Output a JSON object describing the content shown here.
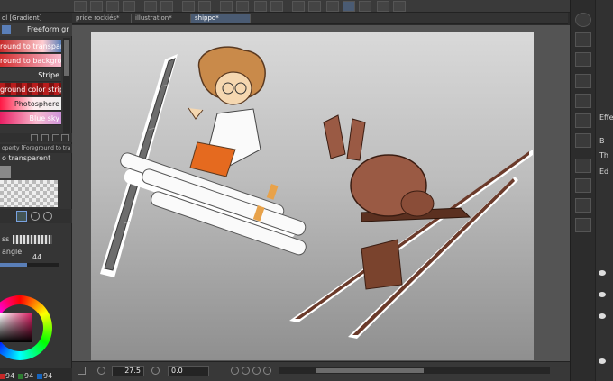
{
  "window": {
    "active_tool_header": "ol [Gradient]"
  },
  "tabs": [
    {
      "label": "pride rockiés*"
    },
    {
      "label": "illustration*"
    },
    {
      "label": "shippo*"
    }
  ],
  "tool_panel": {
    "subtool_label": "Freeform gr",
    "gradients": [
      {
        "label": "round to transparent"
      },
      {
        "label": "round to background"
      },
      {
        "label": "Stripe"
      },
      {
        "label": "ground color stripe"
      },
      {
        "label": "Photosphere"
      },
      {
        "label": "Blue sky"
      }
    ]
  },
  "tool_property": {
    "header": "operty [Foreground to tra",
    "gradient_value": "o transparent",
    "shape_label": "ss",
    "angle_label": "angle",
    "angle_value": "44"
  },
  "color": {
    "h": "94",
    "s": "94",
    "v": "94"
  },
  "status": {
    "zoom": "27.5",
    "rotation": "0.0"
  },
  "right_panel": {
    "effect_label": "Effe",
    "label_b": "B",
    "label_th": "Th",
    "label_ed": "Ed"
  },
  "colors": {
    "accent": "#5a7fb8",
    "canvas_top": "#d9d9d9",
    "canvas_bottom": "#8f8f8f"
  }
}
